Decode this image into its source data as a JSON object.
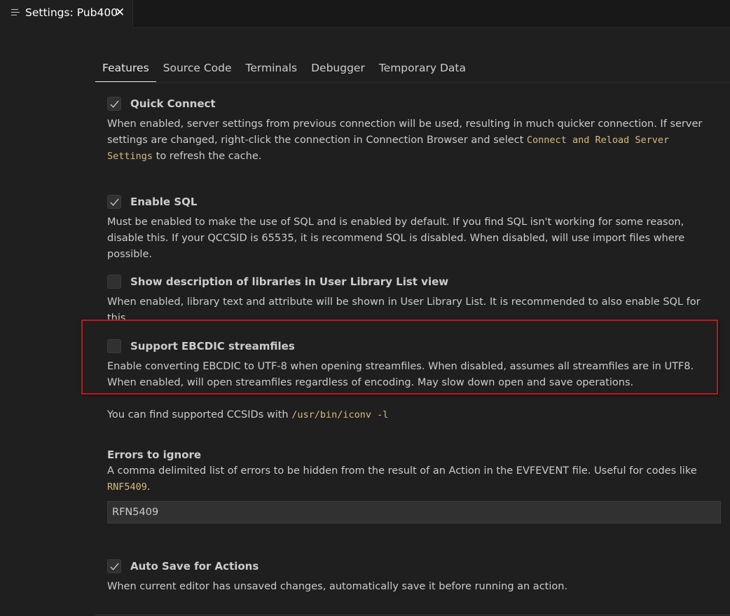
{
  "editor_tab": {
    "title": "Settings: Pub400",
    "close": "✕"
  },
  "settings_tabs": [
    "Features",
    "Source Code",
    "Terminals",
    "Debugger",
    "Temporary Data"
  ],
  "settings": {
    "quick_connect": {
      "label": "Quick Connect",
      "checked": true,
      "desc_before": "When enabled, server settings from previous connection will be used, resulting in much quicker connection. If server settings are changed, right-click the connection in Connection Browser and select ",
      "desc_code": "Connect and Reload Server Settings",
      "desc_after": " to refresh the cache."
    },
    "enable_sql": {
      "label": "Enable SQL",
      "checked": true,
      "desc": "Must be enabled to make the use of SQL and is enabled by default. If you find SQL isn't working for some reason, disable this. If your QCCSID is 65535, it is recommend SQL is disabled. When disabled, will use import files where possible."
    },
    "show_lib_desc": {
      "label": "Show description of libraries in User Library List view",
      "checked": false,
      "desc": "When enabled, library text and attribute will be shown in User Library List. It is recommended to also enable SQL for this."
    },
    "ebcdic": {
      "label": "Support EBCDIC streamfiles",
      "checked": false,
      "desc": "Enable converting EBCDIC to UTF-8 when opening streamfiles. When disabled, assumes all streamfiles are in UTF8. When enabled, will open streamfiles regardless of encoding. May slow down open and save operations."
    },
    "ccsid_note": {
      "text": "You can find supported CCSIDs with ",
      "code": "/usr/bin/iconv -l"
    },
    "errors_to_ignore": {
      "title": "Errors to ignore",
      "desc_before": "A comma delimited list of errors to be hidden from the result of an Action in the EVFEVENT file. Useful for codes like ",
      "desc_code": "RNF5409",
      "desc_after": ".",
      "value": "RFN5409"
    },
    "auto_save": {
      "label": "Auto Save for Actions",
      "checked": true,
      "desc": "When current editor has unsaved changes, automatically save it before running an action."
    }
  },
  "colors": {
    "background": "#1f1f1f",
    "code": "#d7ba7d",
    "highlight_border": "#c4161c"
  },
  "icons": {
    "tab_icon": "settings-lines-icon",
    "check": "check-icon"
  }
}
